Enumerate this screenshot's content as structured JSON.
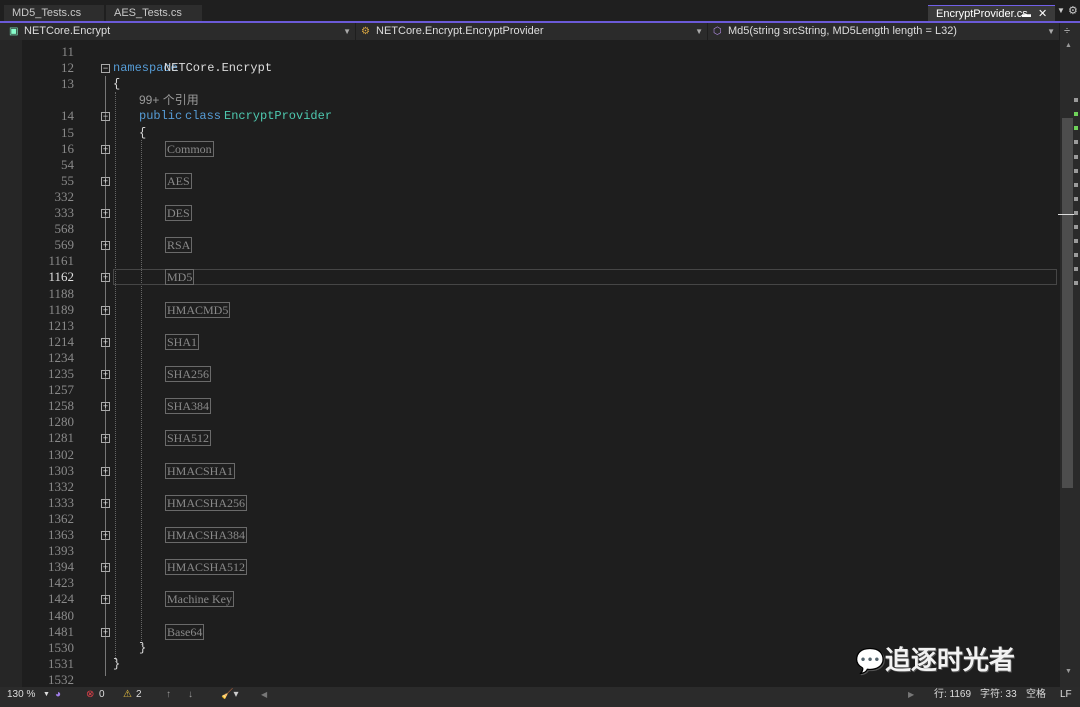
{
  "tabs": [
    {
      "label": "MD5_Tests.cs"
    },
    {
      "label": "AES_Tests.cs"
    },
    {
      "label": "EncryptProvider.cs",
      "active": true
    }
  ],
  "nav": {
    "project": "NETCore.Encrypt",
    "type": "NETCore.Encrypt.EncryptProvider",
    "member": "Md5(string srcString, MD5Length length = L32)"
  },
  "code": {
    "namespace_kw": "namespace",
    "namespace_name": "NETCore.Encrypt",
    "open_brace": "{",
    "close_brace": "}",
    "ref_count": "99+ 个引用",
    "public_kw": "public",
    "class_kw": "class",
    "class_name": "EncryptProvider"
  },
  "lines": [
    "11",
    "12",
    "13",
    "",
    "14",
    "15",
    "16",
    "54",
    "55",
    "332",
    "333",
    "568",
    "569",
    "1161",
    "1162",
    "1188",
    "1189",
    "1213",
    "1214",
    "1234",
    "1235",
    "1257",
    "1258",
    "1280",
    "1281",
    "1302",
    "1303",
    "1332",
    "1333",
    "1362",
    "1363",
    "1393",
    "1394",
    "1423",
    "1424",
    "1480",
    "1481",
    "1530",
    "1531",
    "1532"
  ],
  "regions": [
    "Common",
    "AES",
    "DES",
    "RSA",
    "MD5",
    "HMACMD5",
    "SHA1",
    "SHA256",
    "SHA384",
    "SHA512",
    "HMACSHA1",
    "HMACSHA256",
    "HMACSHA384",
    "HMACSHA512",
    "Machine Key",
    "Base64"
  ],
  "current_line": "1162",
  "status": {
    "zoom": "130 %",
    "errors": "0",
    "warnings": "2",
    "line": "行: 1169",
    "char": "字符: 33",
    "indent": "空格",
    "eol": "LF"
  },
  "watermark": "追逐时光者",
  "colors": {
    "accent": "#6b5ad8",
    "keyword": "#569cd6",
    "type": "#4ec9b0"
  }
}
